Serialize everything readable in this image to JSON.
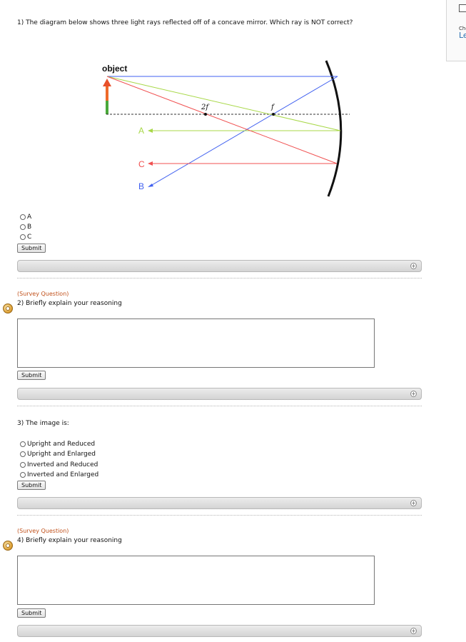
{
  "q1": {
    "text": "1) The diagram below shows three light rays reflected off of a concave mirror. Which ray is NOT correct?",
    "diagram": {
      "object_label": "object",
      "two_f_label": "2f",
      "f_label": "f",
      "ray_a": "A",
      "ray_b": "B",
      "ray_c": "C"
    },
    "options": [
      "A",
      "B",
      "C"
    ],
    "submit_label": "Submit"
  },
  "q2": {
    "survey_tag": "(Survey Question)",
    "text": "2) Briefly explain your reasoning",
    "answer_value": "",
    "submit_label": "Submit"
  },
  "q3": {
    "text": "3) The image is:",
    "options": [
      "Upright and Reduced",
      "Upright and Enlarged",
      "Inverted and Reduced",
      "Inverted and Enlarged"
    ],
    "submit_label": "Submit"
  },
  "q4": {
    "survey_tag": "(Survey Question)",
    "text": "4) Briefly explain your reasoning",
    "answer_value": "",
    "submit_label": "Submit"
  },
  "side_panel": {
    "line1": "Che",
    "line2": "Le"
  },
  "colors": {
    "blue_ray": "#4060f0",
    "green_ray": "#a8d848",
    "red_ray": "#f05050",
    "survey_tag": "#c0501a",
    "link": "#2a6fb0"
  },
  "icons": {
    "feedback_toggle": "plus-circle-icon",
    "survey": "survey-icon"
  }
}
